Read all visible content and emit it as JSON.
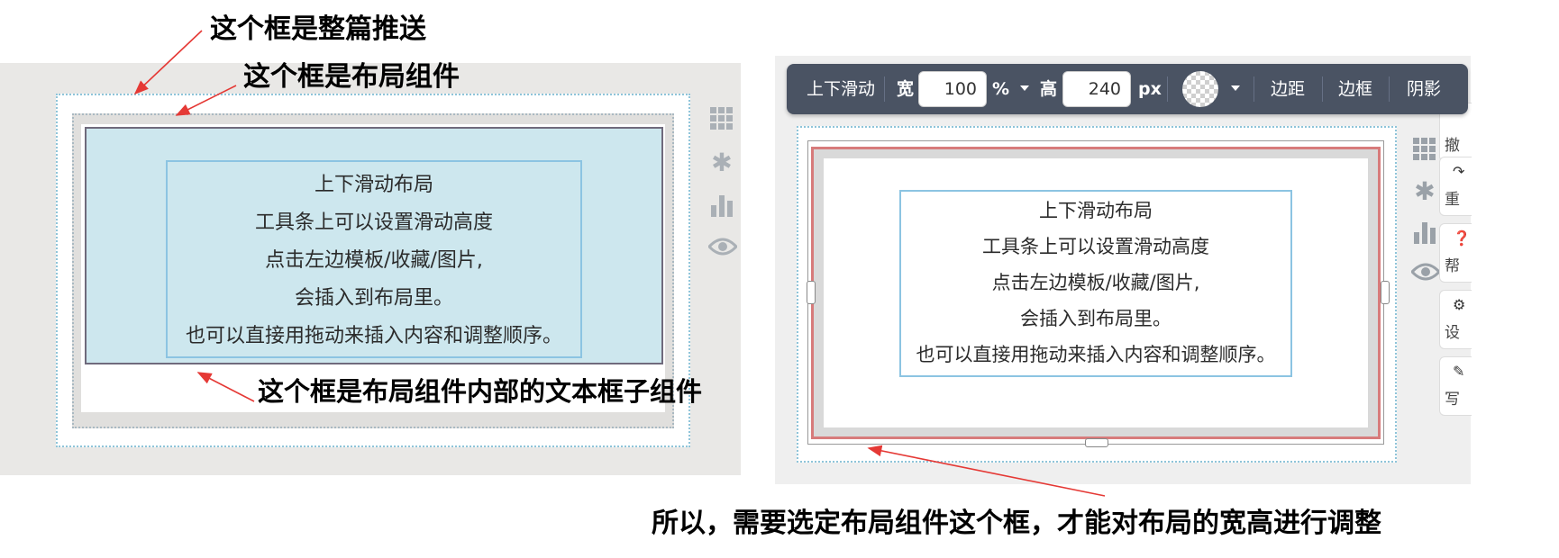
{
  "annotations": {
    "article_frame": "这个框是整篇推送",
    "layout_frame": "这个框是布局组件",
    "text_frame": "这个框是布局组件内部的文本框子组件",
    "conclusion": "所以，需要选定布局组件这个框，才能对布局的宽高进行调整"
  },
  "textbox_lines": [
    "上下滑动布局",
    "工具条上可以设置滑动高度",
    "点击左边模板/收藏/图片,",
    "会插入到布局里。",
    "也可以直接用拖动来插入内容和调整顺序。"
  ],
  "toolbar": {
    "mode_label": "上下滑动",
    "width_label": "宽",
    "width_value": "100",
    "width_unit": "%",
    "height_label": "高",
    "height_value": "240",
    "height_unit": "px",
    "margin_label": "边距",
    "border_label": "边框",
    "shadow_label": "阴影"
  },
  "side_icons": [
    "grid-icon",
    "asterisk-icon",
    "bar-chart-icon",
    "eye-icon"
  ],
  "action_buttons": [
    {
      "label": "撤",
      "icon": "undo-icon"
    },
    {
      "label": "重",
      "icon": "redo-icon"
    },
    {
      "label": "帮",
      "icon": "help-icon"
    },
    {
      "label": "设",
      "icon": "settings-icon"
    },
    {
      "label": "写",
      "icon": "pen-icon"
    }
  ],
  "colors": {
    "toolbar_bg": "#4a5363",
    "layout_fill": "#cde7ee",
    "selected_border": "#d77b7b",
    "annotation_arrow": "#e53935"
  }
}
